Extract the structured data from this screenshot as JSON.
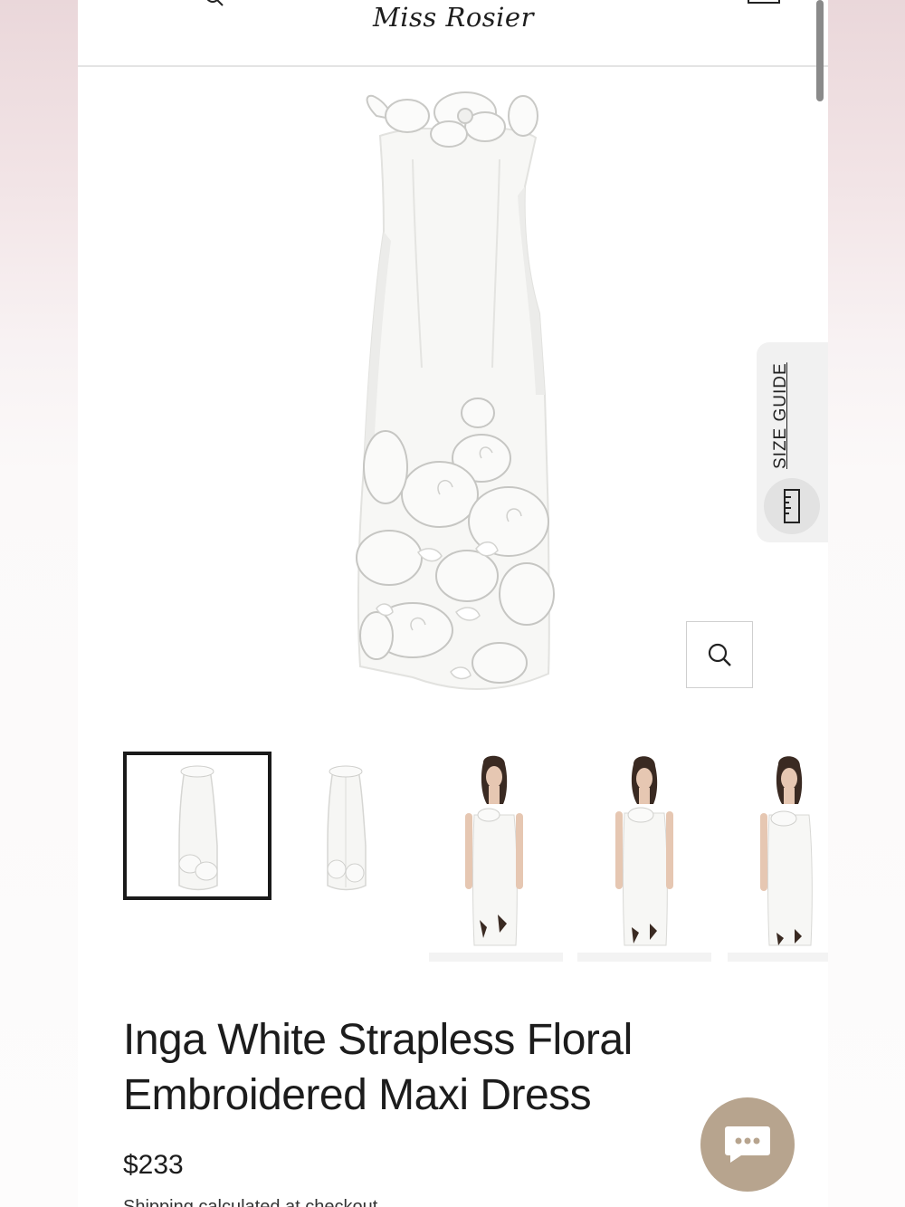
{
  "header": {
    "logo": "Miss Rosier"
  },
  "icons": {
    "menu": "hamburger-menu-icon",
    "search": "search-icon",
    "cart": "cart-icon",
    "zoom": "zoom-icon",
    "ruler": "ruler-icon",
    "chat": "chat-icon"
  },
  "size_guide": {
    "label": "SIZE GUIDE"
  },
  "product": {
    "title_line1": "Inga White Strapless Floral",
    "title_line2": "Embroidered Maxi Dress",
    "price": "$233",
    "shipping": "Shipping calculated at checkout."
  },
  "thumbnails": [
    {
      "label": "front view",
      "selected": true
    },
    {
      "label": "back view",
      "selected": false
    },
    {
      "label": "model view 1",
      "selected": false
    },
    {
      "label": "model view 2",
      "selected": false
    },
    {
      "label": "model view 3",
      "selected": false
    }
  ],
  "colors": {
    "chat_button": "#b7a48e",
    "text": "#1c1c1c",
    "dress": "#f6f6f4"
  }
}
